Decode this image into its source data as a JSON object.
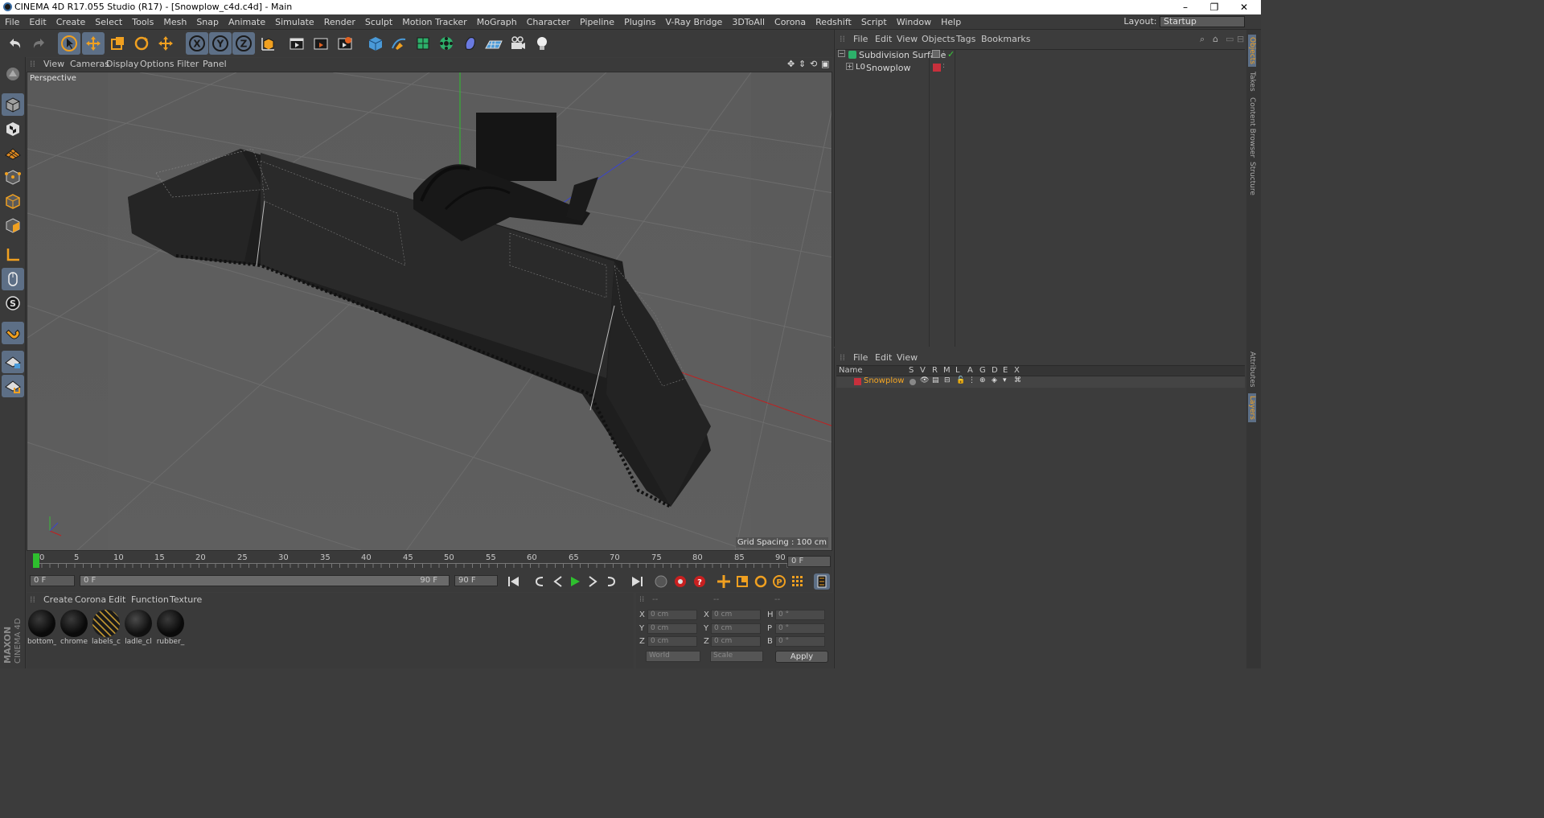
{
  "window": {
    "title": "CINEMA 4D R17.055 Studio (R17) - [Snowplow_c4d.c4d] - Main"
  },
  "menu": [
    "File",
    "Edit",
    "Create",
    "Select",
    "Tools",
    "Mesh",
    "Snap",
    "Animate",
    "Simulate",
    "Render",
    "Sculpt",
    "Motion Tracker",
    "MoGraph",
    "Character",
    "Pipeline",
    "Plugins",
    "V-Ray Bridge",
    "3DToAll",
    "Corona",
    "Redshift",
    "Script",
    "Window",
    "Help"
  ],
  "layout": {
    "label": "Layout:",
    "value": "Startup"
  },
  "viewport": {
    "menu": [
      "View",
      "Cameras",
      "Display",
      "Options",
      "Filter",
      "Panel"
    ],
    "label": "Perspective",
    "grid_spacing": "Grid Spacing : 100 cm"
  },
  "timeline": {
    "ticks": [
      "0",
      "5",
      "10",
      "15",
      "20",
      "25",
      "30",
      "35",
      "40",
      "45",
      "50",
      "55",
      "60",
      "65",
      "70",
      "75",
      "80",
      "85",
      "90"
    ],
    "current_frame": "0 F",
    "start": "0 F",
    "range_start": "0 F",
    "range_end": "90 F",
    "end": "90 F"
  },
  "materials": {
    "menu": [
      "Create",
      "Corona",
      "Edit",
      "Function",
      "Texture"
    ],
    "items": [
      "bottom_",
      "chrome",
      "labels_c",
      "ladle_cl",
      "rubber_"
    ]
  },
  "coords": {
    "headers": [
      "--",
      "--",
      "--"
    ],
    "rows": [
      {
        "a": "X",
        "av": "0 cm",
        "b": "X",
        "bv": "0 cm",
        "c": "H",
        "cv": "0 °"
      },
      {
        "a": "Y",
        "av": "0 cm",
        "b": "Y",
        "bv": "0 cm",
        "c": "P",
        "cv": "0 °"
      },
      {
        "a": "Z",
        "av": "0 cm",
        "b": "Z",
        "bv": "0 cm",
        "c": "B",
        "cv": "0 °"
      }
    ],
    "world": "World",
    "scale": "Scale",
    "apply": "Apply"
  },
  "object_manager": {
    "menu": [
      "File",
      "Edit",
      "View",
      "Objects",
      "Tags",
      "Bookmarks"
    ],
    "objects": [
      {
        "name": "Subdivision Surface"
      },
      {
        "name": "Snowplow"
      }
    ]
  },
  "layer_manager": {
    "menu": [
      "File",
      "Edit",
      "View"
    ],
    "columns": [
      "Name",
      "S",
      "V",
      "R",
      "M",
      "L",
      "A",
      "G",
      "D",
      "E",
      "X"
    ],
    "layers": [
      {
        "name": "Snowplow",
        "color": "#c8303c"
      }
    ]
  },
  "right_tabs": [
    "Objects",
    "Takes",
    "Content Browser",
    "Structure",
    "Attributes",
    "Layers"
  ],
  "brand": "MAXON CINEMA 4D",
  "colors": {
    "accent": "#5d6f86",
    "layer_name": "#f5a623",
    "tool_orange": "#f0a020"
  }
}
